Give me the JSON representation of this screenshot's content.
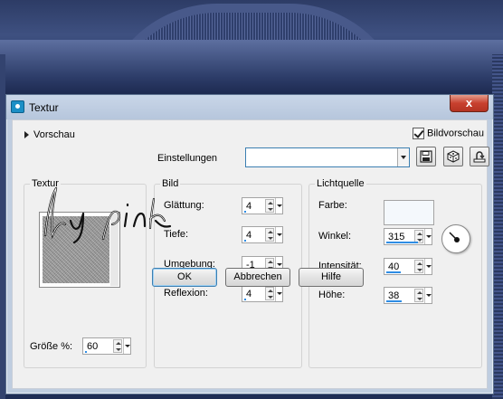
{
  "window": {
    "title": "Textur",
    "close_label": "x"
  },
  "preview": {
    "label": "Vorschau"
  },
  "bildvorschau": {
    "label": "Bildvorschau",
    "checked": true
  },
  "einstellungen": {
    "label": "Einstellungen",
    "value": ""
  },
  "toolbar": {
    "icons": [
      "save-icon",
      "dice-random-icon",
      "reset-icon"
    ]
  },
  "textur": {
    "title": "Textur",
    "size_label": "Größe %:",
    "size_value": "60",
    "size_fill": 0.06
  },
  "bild": {
    "title": "Bild",
    "fields": [
      {
        "label": "Glättung:",
        "value": "4",
        "fill": 0.04
      },
      {
        "label": "Tiefe:",
        "value": "4",
        "fill": 0.04
      },
      {
        "label": "Umgebung:",
        "value": "-1",
        "fill": 0.48
      },
      {
        "label": "Reflexion:",
        "value": "4",
        "fill": 0.04
      }
    ]
  },
  "lichtquelle": {
    "title": "Lichtquelle",
    "color_label": "Farbe:",
    "color": "#f4f8fc",
    "fields": [
      {
        "label": "Winkel:",
        "value": "315",
        "fill": 0.88
      },
      {
        "label": "Intensität:",
        "value": "40",
        "fill": 0.4
      },
      {
        "label": "Höhe:",
        "value": "38",
        "fill": 0.42
      }
    ]
  },
  "buttons": {
    "ok": "OK",
    "cancel": "Abbrechen",
    "help": "Hilfe"
  },
  "watermark": {
    "text": "by pink"
  },
  "colors": {
    "accent": "#2f8de4",
    "dialog_frame": "#bfcde0",
    "close": "#c8412f"
  }
}
